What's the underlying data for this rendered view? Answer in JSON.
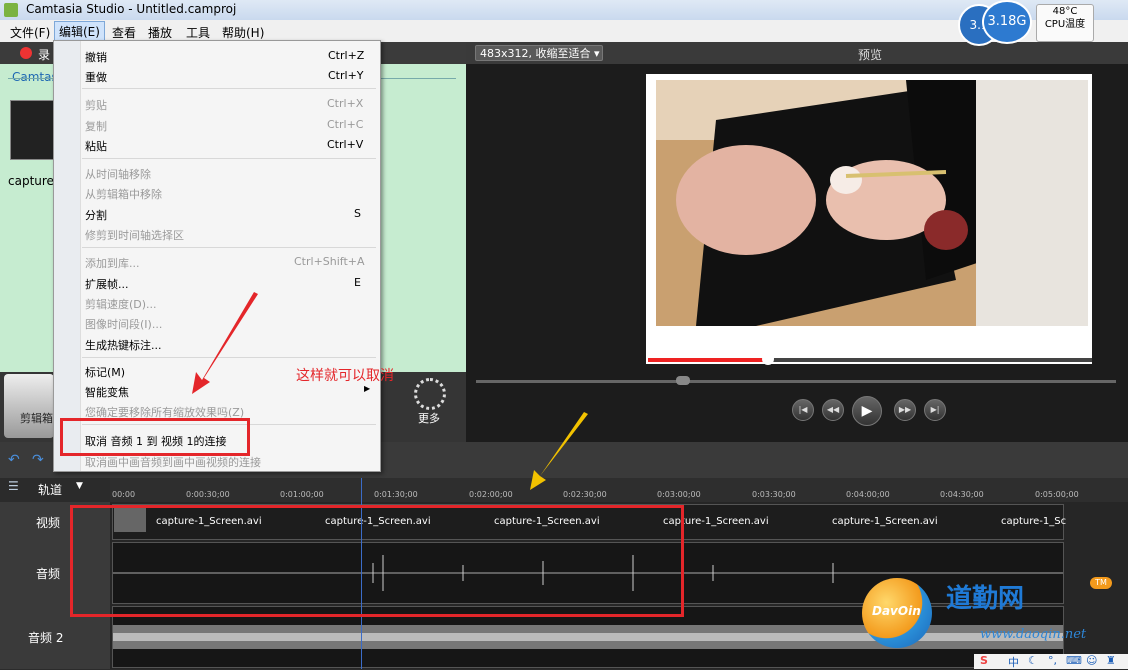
{
  "window": {
    "title": "Camtasia Studio - Untitled.camproj"
  },
  "menubar": [
    "文件(F)",
    "编辑(E)",
    "查看",
    "播放",
    "工具",
    "帮助(H)"
  ],
  "clip_bin": {
    "record_label": "录",
    "tab_label": "Camtas",
    "thumb_label": "capture-",
    "clipbin_button": "剪辑箱",
    "more_button": "更多"
  },
  "preview": {
    "zoom": "483x312, 收缩至适合",
    "title": "预览"
  },
  "edit_menu": {
    "items": [
      {
        "label": "撤销",
        "shortcut": "Ctrl+Z",
        "enabled": true
      },
      {
        "label": "重做",
        "shortcut": "Ctrl+Y",
        "enabled": true
      },
      {
        "label": "剪贴",
        "shortcut": "Ctrl+X",
        "enabled": false
      },
      {
        "label": "复制",
        "shortcut": "Ctrl+C",
        "enabled": false
      },
      {
        "label": "粘贴",
        "shortcut": "Ctrl+V",
        "enabled": true
      },
      {
        "label": "从时间轴移除",
        "shortcut": "",
        "enabled": false
      },
      {
        "label": "从剪辑箱中移除",
        "shortcut": "",
        "enabled": false
      },
      {
        "label": "分割",
        "shortcut": "S",
        "enabled": true
      },
      {
        "label": "修剪到时间轴选择区",
        "shortcut": "",
        "enabled": false
      },
      {
        "label": "添加到库...",
        "shortcut": "Ctrl+Shift+A",
        "enabled": false
      },
      {
        "label": "扩展帧...",
        "shortcut": "E",
        "enabled": true
      },
      {
        "label": "剪辑速度(D)...",
        "shortcut": "",
        "enabled": false
      },
      {
        "label": "图像时间段(I)...",
        "shortcut": "",
        "enabled": false
      },
      {
        "label": "生成热键标注...",
        "shortcut": "",
        "enabled": true
      },
      {
        "label": "标记(M)",
        "shortcut": "",
        "enabled": true
      },
      {
        "label": "智能变焦",
        "shortcut": "",
        "enabled": true
      },
      {
        "label": "您确定要移除所有缩放效果吗(Z)",
        "shortcut": "",
        "enabled": false
      },
      {
        "label": "取消 音频 1 到 视频 1的连接",
        "shortcut": "",
        "enabled": true
      },
      {
        "label": "取消画中画音频到画中画视频的连接",
        "shortcut": "",
        "enabled": false
      }
    ]
  },
  "annotation": "这样就可以取消",
  "timeline": {
    "track_header": "轨道",
    "ruler": [
      "00:00",
      "0:00:30;00",
      "0:01:00;00",
      "0:01:30;00",
      "0:02:00;00",
      "0:02:30;00",
      "0:03:00;00",
      "0:03:30;00",
      "0:04:00;00",
      "0:04:30;00",
      "0:05:00;00"
    ],
    "tracks": {
      "video": "视频",
      "audio": "音频",
      "audio2": "音频 2"
    },
    "clips": [
      "capture-1_Screen.avi",
      "capture-1_Screen.avi",
      "capture-1_Screen.avi",
      "capture-1_Screen.avi",
      "capture-1_Screen.avi",
      "capture-1_Sc"
    ]
  },
  "system": {
    "temp": "48°C",
    "cpu_label": "CPU温度",
    "ball1": "3.1",
    "ball2": "3.18G"
  },
  "watermark": {
    "logo_text": "DavOin",
    "brand_cn": "道勤网",
    "url": "www.daoqin.net",
    "tm": "TM"
  },
  "ime": {
    "s": "S",
    "zh": "中"
  },
  "colors": {
    "highlight": "#e4262a",
    "clip_bg": "#c6ecd0",
    "playhead": "#3b6cc8"
  }
}
